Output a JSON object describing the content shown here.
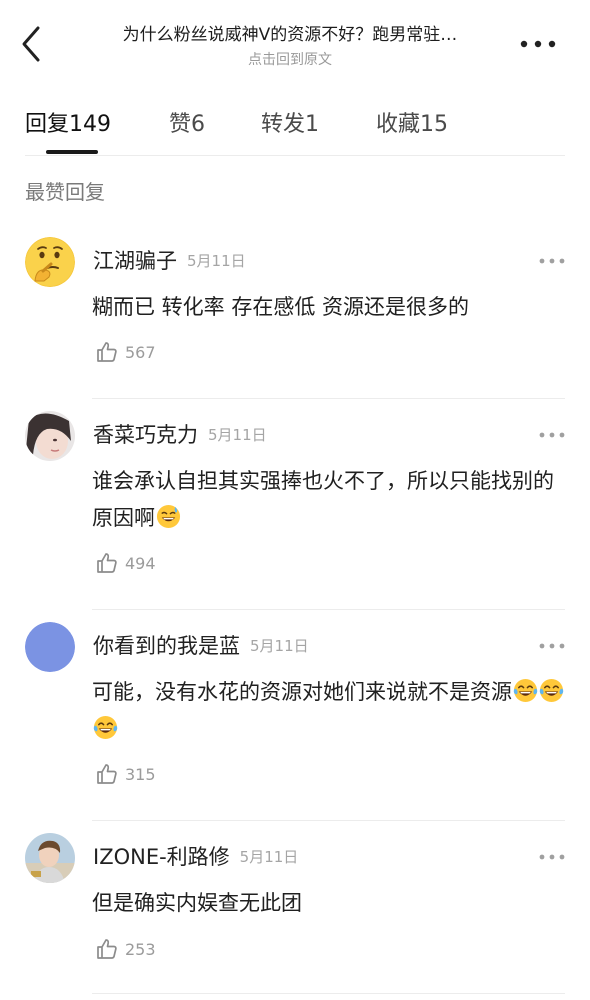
{
  "header": {
    "title": "为什么粉丝说威神V的资源不好？跑男常驻…",
    "subtitle": "点击回到原文"
  },
  "tabs": [
    {
      "label": "回复",
      "count": "149",
      "active": true
    },
    {
      "label": "赞",
      "count": "6",
      "active": false
    },
    {
      "label": "转发",
      "count": "1",
      "active": false
    },
    {
      "label": "收藏",
      "count": "15",
      "active": false
    }
  ],
  "section_title": "最赞回复",
  "comments": [
    {
      "username": "江湖骗子",
      "date": "5月11日",
      "text": "糊而已 转化率 存在感低 资源还是很多的",
      "likes": "567",
      "avatar": "thinking-emoji-avatar"
    },
    {
      "username": "香菜巧克力",
      "date": "5月11日",
      "text": "谁会承认自担其实强捧也火不了，所以只能找别的原因啊",
      "emojis": [
        "sweat-smile-emoji"
      ],
      "likes": "494",
      "avatar": "photo-avatar"
    },
    {
      "username": "你看到的我是蓝",
      "date": "5月11日",
      "text": "可能，没有水花的资源对她们来说就不是资源",
      "emojis": [
        "crying-laughing-emoji",
        "crying-laughing-emoji",
        "crying-laughing-emoji"
      ],
      "likes": "315",
      "avatar": "blue-circle-avatar",
      "avatar_color": "#7B93E3"
    },
    {
      "username": "IZONE-利路修",
      "date": "5月11日",
      "text": "但是确实内娱查无此团",
      "likes": "253",
      "avatar": "photo-avatar"
    }
  ]
}
